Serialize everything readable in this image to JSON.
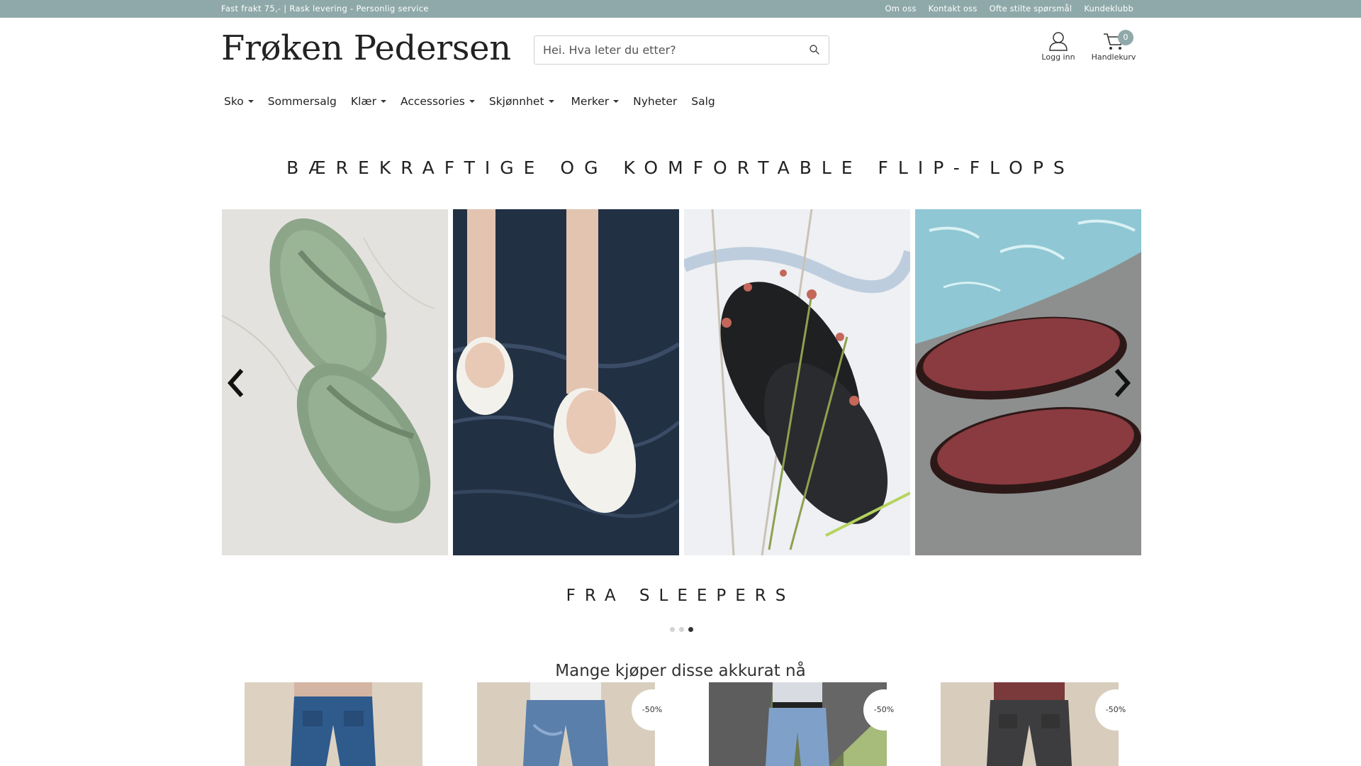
{
  "topbar": {
    "tagline": "Fast frakt 75,- | Rask levering - Personlig service",
    "links": [
      "Om oss",
      "Kontakt oss",
      "Ofte stilte spørsmål",
      "Kundeklubb"
    ]
  },
  "header": {
    "logo": "Frøken Pedersen",
    "search_placeholder": "Hei. Hva leter du etter?",
    "account_label": "Logg inn",
    "cart_label": "Handlekurv",
    "cart_count": "0"
  },
  "nav": {
    "items": [
      {
        "label": "Sko",
        "dropdown": true
      },
      {
        "label": "Sommersalg",
        "dropdown": false
      },
      {
        "label": "Klær",
        "dropdown": true
      },
      {
        "label": "Accessories",
        "dropdown": true
      },
      {
        "label": "Skjønnhet",
        "dropdown": true
      },
      {
        "label": "Merker",
        "dropdown": true
      },
      {
        "label": "Nyheter",
        "dropdown": false
      },
      {
        "label": "Salg",
        "dropdown": false
      }
    ]
  },
  "hero": {
    "title": "BÆREKRAFTIGE OG KOMFORTABLE FLIP-FLOPS",
    "subtitle": "FRA SLEEPERS",
    "slides": [
      "green flip-flops on marble",
      "white flip-flops in water",
      "black flip-flops with flowers",
      "red flip-flops by pool"
    ],
    "active_dot": 2,
    "dot_count": 3
  },
  "products": {
    "title": "Mange kjøper disse akkurat nå",
    "badges": [
      "",
      "-50%",
      "-50%",
      "-50%"
    ]
  },
  "colors": {
    "accent": "#8fa9aa",
    "text": "#222222"
  }
}
